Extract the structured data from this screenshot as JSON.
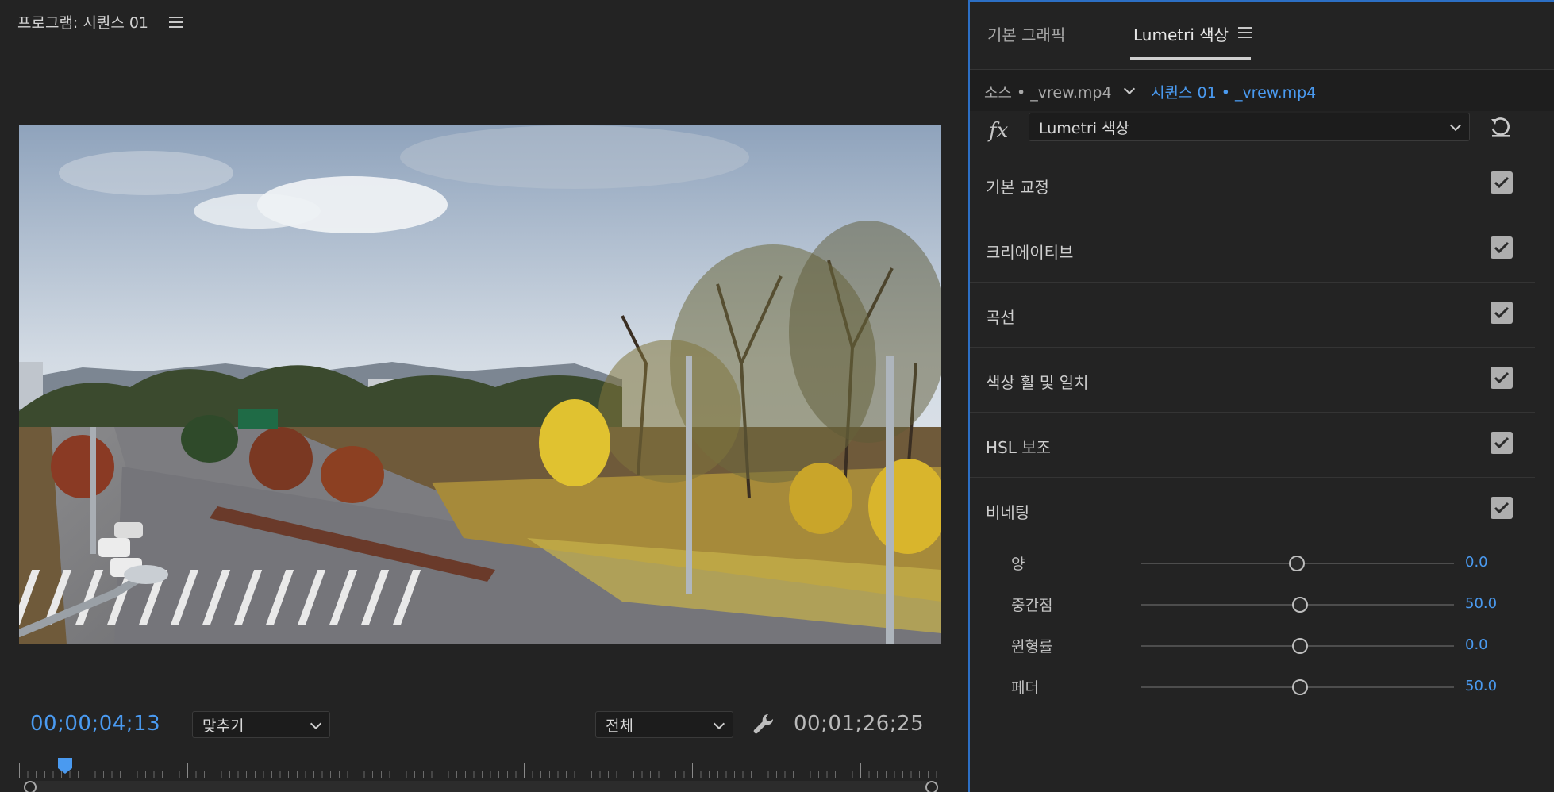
{
  "program": {
    "title": "프로그램: 시퀀스 01",
    "timecode_current": "00;00;04;13",
    "timecode_duration": "00;01;26;25",
    "fit_label": "맞추기",
    "resolution_label": "전체"
  },
  "panel": {
    "tabs": [
      {
        "label": "기본 그래픽"
      },
      {
        "label": "Lumetri 색상"
      }
    ],
    "source_label": "소스 • _vrew.mp4",
    "sequence_label": "시퀀스 01 • _vrew.mp4",
    "fx_label": "fx",
    "effect_select": "Lumetri 색상",
    "sections": [
      {
        "label": "기본 교정",
        "checked": true
      },
      {
        "label": "크리에이티브",
        "checked": true
      },
      {
        "label": "곡선",
        "checked": true
      },
      {
        "label": "색상 휠 및 일치",
        "checked": true
      },
      {
        "label": "HSL 보조",
        "checked": true
      },
      {
        "label": "비네팅",
        "checked": true
      }
    ],
    "vignette_sliders": [
      {
        "label": "양",
        "value": "0.0"
      },
      {
        "label": "중간점",
        "value": "50.0"
      },
      {
        "label": "원형률",
        "value": "0.0"
      },
      {
        "label": "페더",
        "value": "50.0"
      }
    ]
  },
  "colors": {
    "accent": "#4a9af0",
    "panel_border": "#2c6fc4",
    "background": "#232323"
  }
}
